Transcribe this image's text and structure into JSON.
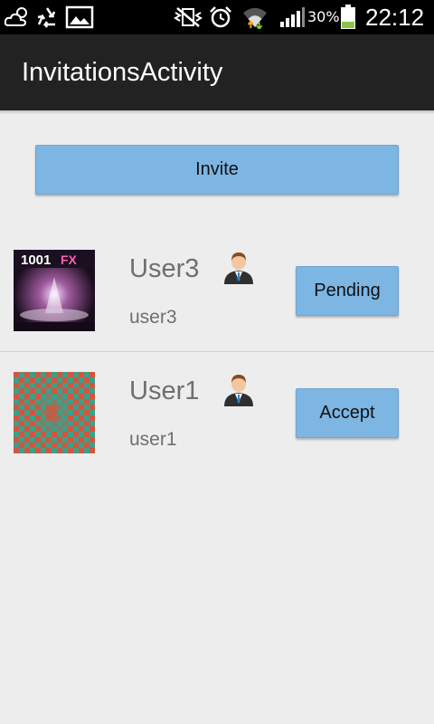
{
  "status_bar": {
    "battery_percent": "30%",
    "time": "22:12",
    "icons": [
      "weather-icon",
      "recycle-icon",
      "image-icon",
      "vibrate-icon",
      "alarm-icon",
      "wifi-icon",
      "signal-icon",
      "battery-icon"
    ],
    "battery_level": 0.3,
    "battery_color": "#8bc34a"
  },
  "action_bar": {
    "title": "InvitationsActivity"
  },
  "invite_button": {
    "label": "Invite"
  },
  "invitations": [
    {
      "display_name": "User3",
      "username": "user3",
      "action_label": "Pending",
      "avatar": "album-art-image"
    },
    {
      "display_name": "User1",
      "username": "user1",
      "action_label": "Accept",
      "avatar": "checker-pattern-image"
    }
  ],
  "colors": {
    "button_bg": "#7db5e3",
    "action_bar_bg": "#222222",
    "page_bg": "#ededed",
    "text_gray": "#6f6f6f"
  }
}
